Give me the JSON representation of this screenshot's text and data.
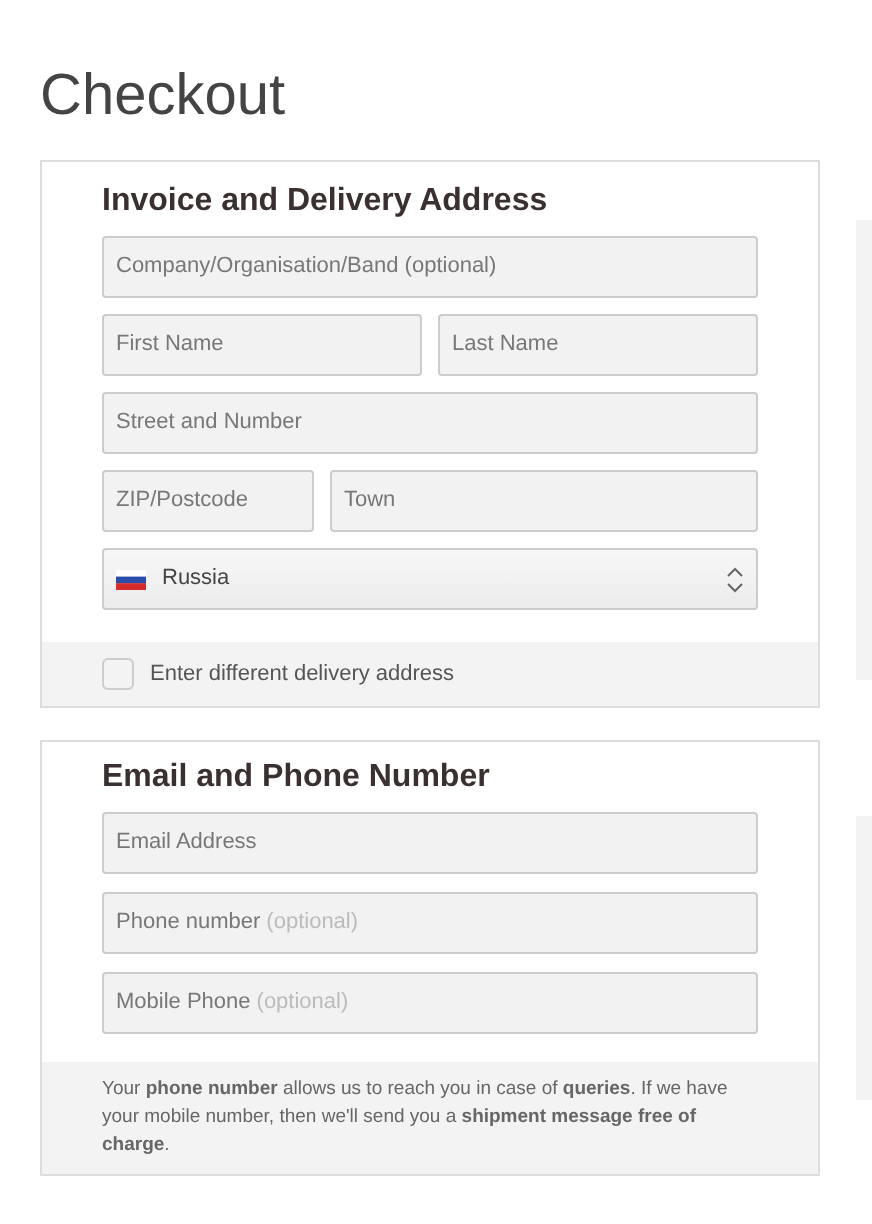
{
  "page_title": "Checkout",
  "address_section": {
    "title": "Invoice and Delivery Address",
    "rows": [
      [
        {
          "placeholder": "Company/Organisation/Band (optional)"
        }
      ],
      [
        {
          "placeholder": "First Name"
        },
        {
          "placeholder": "Last Name"
        }
      ],
      [
        {
          "placeholder": "Street and Number"
        }
      ],
      [
        {
          "placeholder": "ZIP/Postcode"
        },
        {
          "placeholder": "Town"
        }
      ]
    ],
    "country": {
      "value": "Russia"
    },
    "different_delivery": {
      "label": "Enter different delivery address",
      "checked": false
    }
  },
  "contact_section": {
    "title": "Email and Phone Number",
    "fields": [
      {
        "placeholder": "Email Address"
      },
      {
        "placeholder": "Phone number",
        "note": "(optional)"
      },
      {
        "placeholder": "Mobile Phone",
        "note": "(optional)"
      }
    ],
    "info": "Your **phone number** allows us to reach you in case of **queries**. If we have your mobile number, then we'll send you a **shipment message free of charge**."
  }
}
